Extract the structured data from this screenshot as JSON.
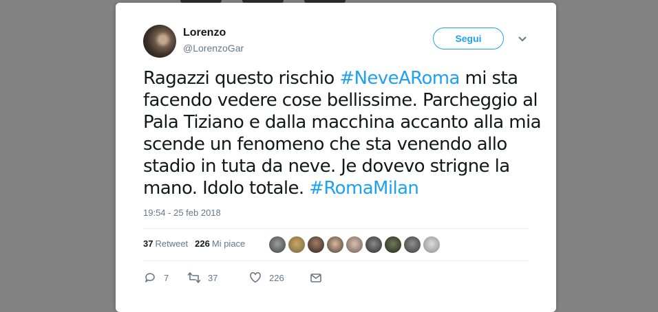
{
  "user": {
    "name": "Lorenzo",
    "handle": "@LorenzoGar"
  },
  "follow_label": "Segui",
  "tweet": {
    "text_1": "Ragazzi questo rischio ",
    "hashtag_1": "#NeveARoma",
    "text_2": " mi sta facendo vedere cose bellissime. Parcheggio al Pala Tiziano e dalla macchina accanto alla mia scende un fenomeno che sta venendo allo stadio in tuta da neve. Je dovevo strigne la mano. Idolo totale. ",
    "hashtag_2": "#RomaMilan"
  },
  "timestamp": "19:54 - 25 feb 2018",
  "stats": {
    "retweets_count": "37",
    "retweets_label": "Retweet",
    "likes_count": "226",
    "likes_label": "Mi piace"
  },
  "actions": {
    "replies": "7",
    "retweets": "37",
    "likes": "226"
  },
  "colors": {
    "accent": "#1da1f2",
    "text": "#14171a",
    "muted": "#657786",
    "border": "#e6ecf0"
  },
  "icons": [
    "chevron-down-icon",
    "reply-icon",
    "retweet-icon",
    "heart-icon",
    "mail-icon"
  ]
}
